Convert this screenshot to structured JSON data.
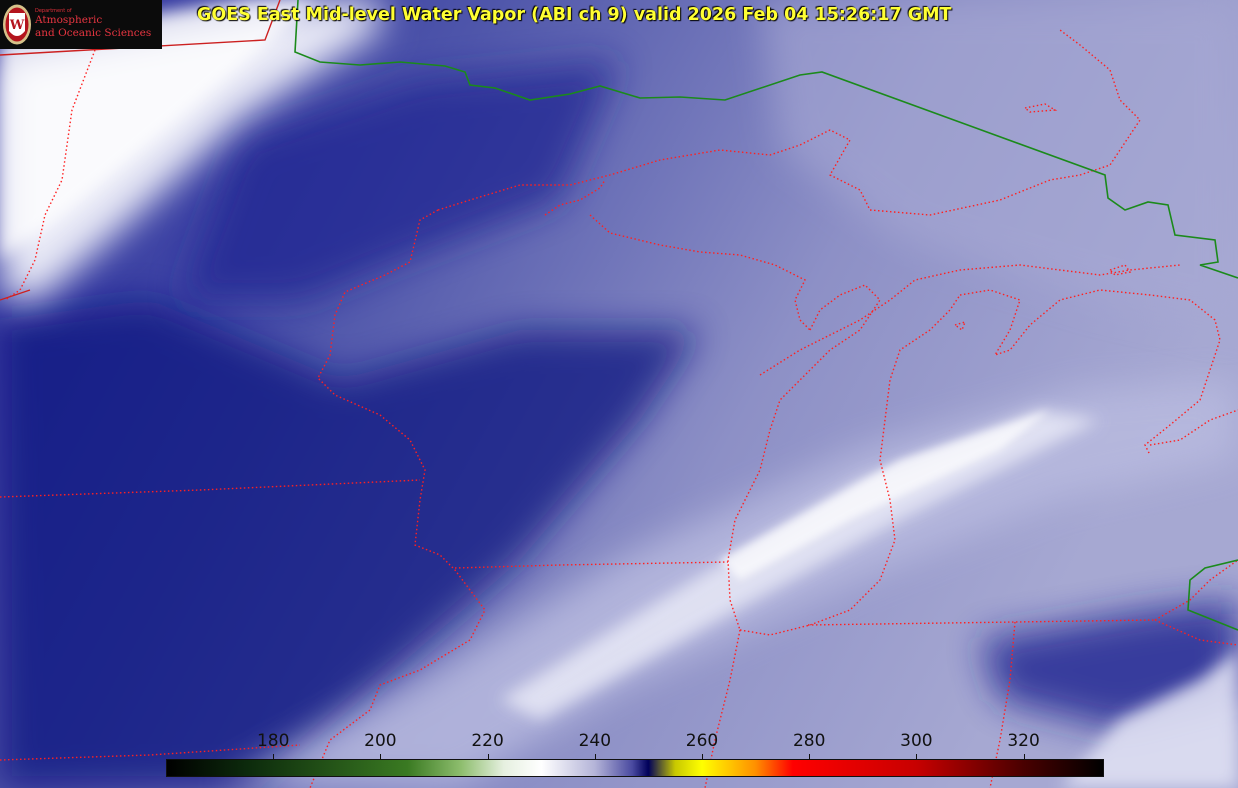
{
  "title": "GOES East Mid-level Water Vapor (ABI ch 9)  valid 2026 Feb 04 15:26:17 GMT",
  "logo": {
    "dept_line": "Department of",
    "line1": "Atmospheric",
    "line2": "and Oceanic Sciences",
    "seal_letter": "W"
  },
  "colorbar": {
    "min": 160,
    "max": 335,
    "ticks": [
      "180",
      "200",
      "220",
      "240",
      "260",
      "280",
      "300",
      "320"
    ],
    "tick_values": [
      180,
      200,
      220,
      240,
      260,
      280,
      300,
      320
    ],
    "stops": [
      {
        "value": 160,
        "color": "#000000"
      },
      {
        "value": 175,
        "color": "#0c2a0c"
      },
      {
        "value": 205,
        "color": "#3a7a22"
      },
      {
        "value": 215,
        "color": "#8ebe6e"
      },
      {
        "value": 223,
        "color": "#e6f0e0"
      },
      {
        "value": 230,
        "color": "#ffffff"
      },
      {
        "value": 240,
        "color": "#b4b4d8"
      },
      {
        "value": 247,
        "color": "#4a4aa0"
      },
      {
        "value": 250,
        "color": "#00005a"
      },
      {
        "value": 255,
        "color": "#c8c800"
      },
      {
        "value": 260,
        "color": "#ffff00"
      },
      {
        "value": 270,
        "color": "#ff9000"
      },
      {
        "value": 277,
        "color": "#ff0000"
      },
      {
        "value": 300,
        "color": "#c80000"
      },
      {
        "value": 320,
        "color": "#4a0000"
      },
      {
        "value": 335,
        "color": "#000000"
      }
    ]
  },
  "colors": {
    "state_borders": "#ff2020",
    "international_border": "#1b8a1b",
    "vapor_dark": "#0a0f80",
    "vapor_light": "#eeeefa"
  }
}
